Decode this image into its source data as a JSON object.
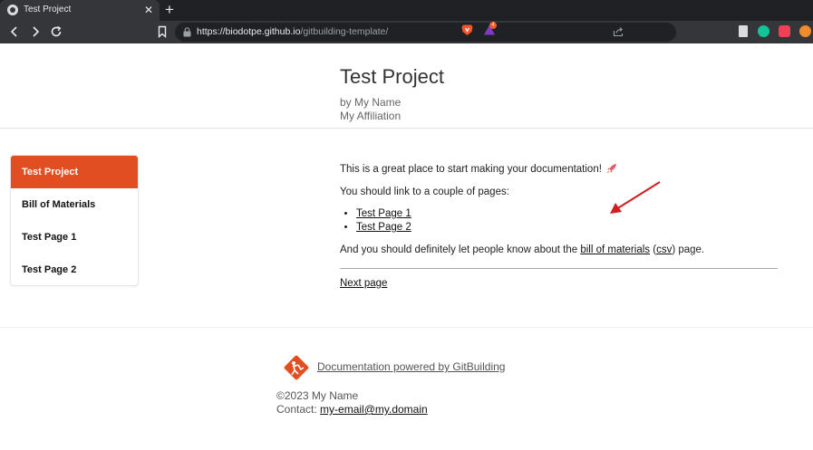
{
  "browser": {
    "tab_title": "Test Project",
    "tab_close": "✕",
    "new_tab": "+",
    "url_host": "https://biodotpe.github.io",
    "url_path": "/gitbuilding-template/",
    "rewards_badge": "4"
  },
  "header": {
    "title": "Test Project",
    "author": "by My Name",
    "affiliation": "My Affiliation"
  },
  "sidebar": {
    "items": [
      {
        "label": "Test Project",
        "active": true
      },
      {
        "label": "Bill of Materials",
        "active": false
      },
      {
        "label": "Test Page 1",
        "active": false
      },
      {
        "label": "Test Page 2",
        "active": false
      }
    ]
  },
  "content": {
    "intro": "This is a great place to start making your documentation!",
    "link_prompt": "You should link to a couple of pages:",
    "links": [
      "Test Page 1",
      "Test Page 2"
    ],
    "bom_before": "And you should definitely let people know about the ",
    "bom_link": "bill of materials",
    "bom_mid": " (",
    "csv_link": "csv",
    "bom_after": ") page.",
    "next_page": "Next page"
  },
  "footer": {
    "powered_by": " Documentation powered by GitBuilding",
    "copyright": "©2023 My Name",
    "contact_label": "Contact: ",
    "contact_email": "my-email@my.domain"
  },
  "colors": {
    "accent": "#e14e22",
    "annotation_arrow": "#d11f1f"
  },
  "icons": [
    "globe-icon",
    "back-icon",
    "forward-icon",
    "reload-icon",
    "bookmark-icon",
    "lock-icon",
    "share-icon",
    "brave-shield-icon",
    "brave-rewards-icon",
    "rocket-icon",
    "gitbuilding-logo-icon"
  ]
}
